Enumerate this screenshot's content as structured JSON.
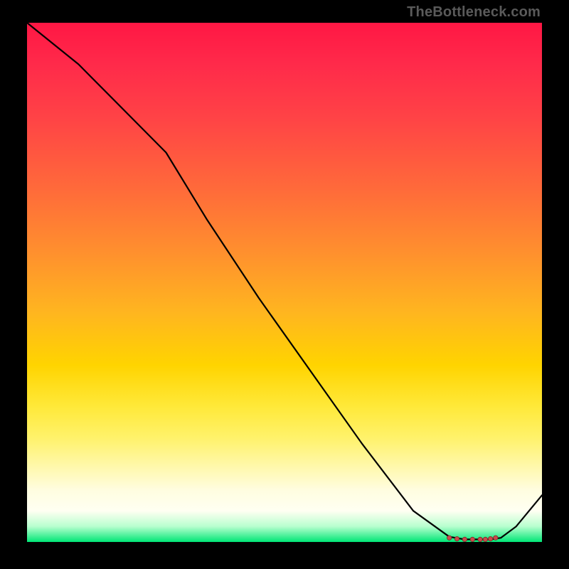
{
  "watermark": "TheBottleneck.com",
  "chart_data": {
    "type": "line",
    "title": "",
    "xlabel": "",
    "ylabel": "",
    "xlim": [
      0,
      100
    ],
    "ylim": [
      0,
      100
    ],
    "grid": false,
    "legend": false,
    "series": [
      {
        "name": "curve",
        "x": [
          0,
          10,
          20,
          27,
          35,
          45,
          55,
          65,
          75,
          82,
          85,
          88,
          90,
          92,
          95,
          100
        ],
        "y": [
          100,
          92,
          82,
          75,
          62,
          47,
          33,
          19,
          6,
          1,
          0.5,
          0.5,
          0.5,
          0.8,
          3,
          9
        ]
      }
    ],
    "markers": {
      "name": "highlight-cluster",
      "x": [
        82,
        83.5,
        85,
        86.5,
        88,
        89,
        90,
        91
      ],
      "y": [
        0.8,
        0.6,
        0.5,
        0.5,
        0.5,
        0.5,
        0.6,
        0.8
      ]
    },
    "background_gradient": {
      "top": "#ff1744",
      "mid_upper": "#ff8f2e",
      "mid": "#ffe93a",
      "lower": "#fffde0",
      "bottom": "#00e676"
    }
  }
}
